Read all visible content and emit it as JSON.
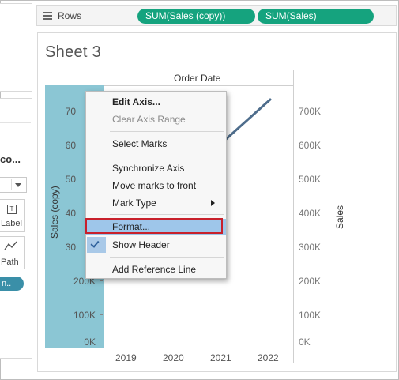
{
  "left_panel": {
    "title_fragment": "co...",
    "card_label": "Label",
    "card_path": "Path",
    "pill_fragment": "n..",
    "label_icon_glyph": "T"
  },
  "rows_shelf": {
    "label": "Rows",
    "icon": "rows-icon",
    "pills": [
      "SUM(Sales (copy))",
      "SUM(Sales)"
    ],
    "pill_color": "#15a37e"
  },
  "sheet": {
    "title": "Sheet 3",
    "column_header": "Order Date",
    "left_axis_title": "Sales (copy)",
    "left_axis_ticks": [
      "70",
      "60",
      "50",
      "40",
      "30",
      "200K",
      "100K",
      "0K"
    ],
    "right_axis_title": "Sales",
    "right_axis_ticks": [
      "700K",
      "600K",
      "500K",
      "400K",
      "300K",
      "200K",
      "100K",
      "0K"
    ],
    "years": [
      "2019",
      "2020",
      "2021",
      "2022"
    ],
    "axis_band_color": "#8bc6d4",
    "line_color": "#4e6d8c"
  },
  "context_menu": {
    "items": {
      "edit_axis": "Edit Axis...",
      "clear_axis_range": "Clear Axis Range",
      "select_marks": "Select Marks",
      "synchronize_axis": "Synchronize Axis",
      "move_marks_to_front": "Move marks to front",
      "mark_type": "Mark Type",
      "format": "Format...",
      "show_header": "Show Header",
      "add_reference_line": "Add Reference Line"
    },
    "highlighted": "Format...",
    "checked": "Show Header",
    "highlight_color": "#9ec6ea",
    "outline_color": "#c8202b"
  }
}
